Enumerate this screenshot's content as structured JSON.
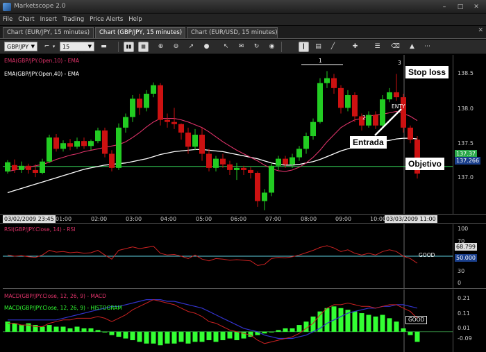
{
  "app": {
    "title": "Marketscope 2.0",
    "window_buttons": [
      "–",
      "□",
      "✕"
    ]
  },
  "menu": [
    "File",
    "Chart",
    "Insert",
    "Trading",
    "Price Alerts",
    "Help"
  ],
  "tabs": [
    {
      "label": "Chart (EUR/JPY, 15 minutes)",
      "active": false
    },
    {
      "label": "Chart (GBP/JPY, 15 minutes)",
      "active": true
    },
    {
      "label": "Chart (EUR/USD, 15 minutes)",
      "active": false
    }
  ],
  "tabs_close": "✕",
  "toolbar": {
    "symbol": "GBP/JPY",
    "timeframe": "15 minutes",
    "icons": [
      "glasses-icon",
      "bar-chart-icon",
      "zoom-in-icon",
      "zoom-out-icon",
      "crosshair-icon",
      "arrow-cursor-icon",
      "dot-icon",
      "cursor-icon",
      "note-icon",
      "refresh-icon",
      "globe-icon",
      "vertical-line-icon",
      "calendar-icon",
      "trend-line-icon",
      "level-icon",
      "properties-icon",
      "eraser-icon",
      "pyramid-icon"
    ]
  },
  "colors": {
    "bull": "#22cc22",
    "bear": "#cc1111",
    "ema10": "#e0336a",
    "ema40": "#ffffff",
    "rsi": "#cc2222",
    "macd": "#cc2222",
    "signal": "#3333cc",
    "histogram": "#33ff33",
    "hline": "#33cc55",
    "rsi_level": "#5fd0e0"
  },
  "price_pane": {
    "legend_ema10": "EMA(GBP/JPY.Open,10) - EMA",
    "legend_ema40": "EMA(GBP/JPY.Open,40) - EMA",
    "ticks": [
      "138.5",
      "138.0",
      "137.5",
      "137.0"
    ],
    "current_tag": "137.266",
    "hline_tag": "137.37",
    "annotations": {
      "stop_loss": "Stop loss",
      "entrada": "Entrada",
      "objetivo": "Objetivo"
    },
    "markers": {
      "one": "1",
      "two": "2",
      "three": "3",
      "entry": "ENTY"
    }
  },
  "time_axis": {
    "start_box": "03/02/2009 23:45",
    "end_box": "03/03/2009 11:00",
    "labels": [
      "01:00",
      "02:00",
      "03:00",
      "04:00",
      "05:00",
      "06:00",
      "07:00",
      "08:00",
      "09:00",
      "10:00"
    ]
  },
  "rsi_pane": {
    "legend": "RSI(GBP/JPY.Close, 14) - RSI",
    "ticks": [
      "100",
      "70",
      "30",
      "0"
    ],
    "value_tag": "68.799",
    "level_tag": "50.000",
    "good": "GOOD"
  },
  "macd_pane": {
    "legend_macd": "MACD(GBP/JPY.Close, 12, 26, 9) - MACD",
    "legend_hist": "MACD(GBP/JPY.Close, 12, 26, 9) - HISTOGRAM",
    "ticks": [
      "0.21",
      "0.11",
      "0.01",
      "-0.09"
    ],
    "good": "GOOD"
  },
  "chart_data": {
    "type": "candlestick",
    "symbol": "GBP/JPY",
    "ylim": [
      136.7,
      138.95
    ],
    "candles": [
      [
        137.3,
        137.43,
        137.46,
        137.27
      ],
      [
        137.39,
        137.32,
        137.47,
        137.28
      ],
      [
        137.32,
        137.38,
        137.44,
        137.28
      ],
      [
        137.38,
        137.32,
        137.41,
        137.27
      ],
      [
        137.32,
        137.28,
        137.4,
        137.22
      ],
      [
        137.28,
        137.44,
        137.48,
        137.26
      ],
      [
        137.44,
        137.78,
        137.82,
        137.42
      ],
      [
        137.78,
        137.62,
        137.83,
        137.58
      ],
      [
        137.62,
        137.7,
        137.74,
        137.58
      ],
      [
        137.7,
        137.65,
        137.76,
        137.6
      ],
      [
        137.65,
        137.73,
        137.78,
        137.62
      ],
      [
        137.73,
        137.66,
        137.78,
        137.62
      ],
      [
        137.66,
        137.73,
        137.75,
        137.6
      ],
      [
        137.73,
        137.88,
        137.92,
        137.7
      ],
      [
        137.88,
        137.55,
        137.92,
        137.5
      ],
      [
        137.55,
        137.35,
        137.6,
        137.3
      ],
      [
        137.35,
        137.92,
        137.98,
        137.32
      ],
      [
        137.92,
        138.07,
        138.12,
        137.85
      ],
      [
        138.07,
        138.33,
        138.38,
        138.0
      ],
      [
        138.33,
        138.2,
        138.4,
        138.1
      ],
      [
        138.2,
        138.4,
        138.45,
        138.15
      ],
      [
        138.4,
        138.52,
        138.56,
        138.35
      ],
      [
        138.52,
        138.03,
        138.55,
        137.95
      ],
      [
        138.03,
        138.0,
        138.12,
        137.92
      ],
      [
        138.0,
        137.97,
        138.2,
        137.9
      ],
      [
        137.97,
        137.85,
        137.98,
        137.75
      ],
      [
        137.85,
        137.65,
        137.92,
        137.55
      ],
      [
        137.65,
        137.82,
        137.9,
        137.6
      ],
      [
        137.82,
        137.55,
        137.92,
        137.45
      ],
      [
        137.55,
        137.35,
        137.62,
        137.3
      ],
      [
        137.35,
        137.48,
        137.52,
        137.3
      ],
      [
        137.48,
        137.4,
        137.55,
        137.35
      ],
      [
        137.4,
        137.32,
        137.45,
        137.25
      ],
      [
        137.32,
        137.35,
        137.42,
        137.18
      ],
      [
        137.35,
        137.32,
        137.38,
        137.25
      ],
      [
        137.32,
        137.28,
        137.36,
        137.2
      ],
      [
        137.28,
        136.88,
        137.3,
        136.8
      ],
      [
        136.88,
        137.0,
        137.05,
        136.75
      ],
      [
        137.0,
        137.38,
        137.42,
        136.95
      ],
      [
        137.38,
        137.48,
        137.52,
        137.32
      ],
      [
        137.48,
        137.4,
        137.52,
        137.35
      ],
      [
        137.4,
        137.5,
        137.55,
        137.35
      ],
      [
        137.5,
        137.62,
        137.66,
        137.45
      ],
      [
        137.62,
        137.8,
        137.85,
        137.55
      ],
      [
        137.8,
        138.0,
        138.05,
        137.75
      ],
      [
        138.0,
        138.55,
        138.62,
        137.98
      ],
      [
        138.55,
        138.62,
        138.72,
        138.48
      ],
      [
        138.62,
        138.48,
        138.68,
        138.4
      ],
      [
        138.48,
        138.2,
        138.52,
        138.12
      ],
      [
        138.2,
        138.38,
        138.45,
        138.15
      ],
      [
        138.38,
        138.08,
        138.42,
        138.0
      ],
      [
        138.08,
        137.95,
        138.12,
        137.88
      ],
      [
        137.95,
        138.1,
        138.15,
        137.92
      ],
      [
        138.1,
        137.95,
        138.15,
        137.9
      ],
      [
        137.95,
        138.32,
        138.38,
        137.92
      ],
      [
        138.32,
        138.42,
        138.48,
        138.28
      ],
      [
        138.42,
        138.35,
        138.68,
        138.3
      ],
      [
        138.35,
        137.92,
        138.4,
        137.85
      ],
      [
        137.92,
        137.75,
        137.95,
        137.7
      ],
      [
        137.75,
        137.27,
        137.8,
        137.2
      ]
    ],
    "ema10": [
      137.3,
      137.32,
      137.34,
      137.36,
      137.38,
      137.4,
      137.43,
      137.47,
      137.5,
      137.53,
      137.55,
      137.58,
      137.6,
      137.62,
      137.64,
      137.66,
      137.68,
      137.72,
      137.78,
      137.85,
      137.93,
      138.0,
      138.05,
      138.05,
      138.05,
      138.03,
      138.0,
      137.96,
      137.92,
      137.86,
      137.79,
      137.72,
      137.66,
      137.6,
      137.55,
      137.5,
      137.45,
      137.39,
      137.34,
      137.31,
      137.3,
      137.32,
      137.36,
      137.42,
      137.5,
      137.6,
      137.72,
      137.82,
      137.92,
      137.98,
      138.03,
      138.05,
      138.08,
      138.1,
      138.11,
      138.13,
      138.15,
      138.12,
      138.08,
      138.02
    ],
    "ema40": [
      137.0,
      137.03,
      137.06,
      137.09,
      137.12,
      137.15,
      137.18,
      137.21,
      137.24,
      137.27,
      137.3,
      137.33,
      137.35,
      137.37,
      137.39,
      137.4,
      137.41,
      137.42,
      137.44,
      137.46,
      137.48,
      137.51,
      137.54,
      137.56,
      137.58,
      137.59,
      137.6,
      137.61,
      137.61,
      137.6,
      137.59,
      137.58,
      137.56,
      137.54,
      137.52,
      137.5,
      137.48,
      137.45,
      137.42,
      137.4,
      137.39,
      137.39,
      137.4,
      137.42,
      137.44,
      137.47,
      137.51,
      137.55,
      137.59,
      137.62,
      137.65,
      137.67,
      137.69,
      137.71,
      137.73,
      137.74,
      137.76,
      137.77,
      137.77,
      137.76
    ],
    "hline": 137.37,
    "rsi": [
      52,
      50,
      51,
      49,
      48,
      52,
      60,
      57,
      58,
      56,
      57,
      55,
      56,
      60,
      52,
      45,
      60,
      63,
      66,
      63,
      65,
      67,
      55,
      52,
      53,
      50,
      46,
      52,
      45,
      42,
      46,
      45,
      43,
      44,
      43,
      42,
      34,
      36,
      46,
      48,
      47,
      49,
      52,
      56,
      60,
      65,
      68,
      64,
      58,
      61,
      55,
      52,
      55,
      52,
      58,
      61,
      58,
      50,
      46,
      38
    ],
    "rsi_ylim": [
      0,
      100
    ],
    "rsi_level": 50,
    "macd": [
      0.05,
      0.05,
      0.04,
      0.04,
      0.03,
      0.03,
      0.05,
      0.06,
      0.07,
      0.07,
      0.08,
      0.08,
      0.08,
      0.09,
      0.08,
      0.06,
      0.08,
      0.1,
      0.13,
      0.15,
      0.17,
      0.19,
      0.18,
      0.17,
      0.16,
      0.14,
      0.12,
      0.11,
      0.09,
      0.06,
      0.05,
      0.03,
      0.01,
      0.0,
      -0.01,
      -0.02,
      -0.05,
      -0.07,
      -0.06,
      -0.05,
      -0.04,
      -0.03,
      -0.01,
      0.02,
      0.05,
      0.1,
      0.14,
      0.16,
      0.16,
      0.17,
      0.16,
      0.15,
      0.15,
      0.14,
      0.15,
      0.16,
      0.16,
      0.14,
      0.12,
      0.08
    ],
    "signal": [
      0.07,
      0.07,
      0.07,
      0.07,
      0.07,
      0.07,
      0.07,
      0.07,
      0.08,
      0.09,
      0.1,
      0.11,
      0.12,
      0.13,
      0.14,
      0.15,
      0.15,
      0.16,
      0.17,
      0.18,
      0.19,
      0.19,
      0.19,
      0.18,
      0.18,
      0.17,
      0.16,
      0.15,
      0.14,
      0.12,
      0.1,
      0.08,
      0.06,
      0.04,
      0.02,
      0.01,
      0.0,
      -0.02,
      -0.03,
      -0.04,
      -0.04,
      -0.04,
      -0.03,
      -0.02,
      0.0,
      0.02,
      0.05,
      0.07,
      0.09,
      0.11,
      0.12,
      0.13,
      0.14,
      0.14,
      0.15,
      0.15,
      0.16,
      0.16,
      0.15,
      0.14
    ],
    "histogram": [
      0.06,
      0.05,
      0.04,
      0.05,
      0.04,
      0.03,
      0.04,
      0.03,
      0.03,
      0.02,
      0.03,
      0.02,
      0.02,
      0.01,
      0.0,
      -0.02,
      -0.03,
      -0.04,
      -0.05,
      -0.06,
      -0.07,
      -0.07,
      -0.08,
      -0.07,
      -0.07,
      -0.06,
      -0.07,
      -0.06,
      -0.06,
      -0.05,
      -0.06,
      -0.05,
      -0.04,
      -0.05,
      -0.04,
      -0.03,
      -0.02,
      -0.01,
      0.0,
      0.01,
      0.02,
      0.02,
      0.04,
      0.06,
      0.09,
      0.12,
      0.14,
      0.15,
      0.14,
      0.13,
      0.12,
      0.11,
      0.1,
      0.09,
      0.1,
      0.08,
      0.06,
      0.02,
      -0.02,
      -0.06
    ],
    "macd_ylim": [
      -0.12,
      0.25
    ]
  }
}
